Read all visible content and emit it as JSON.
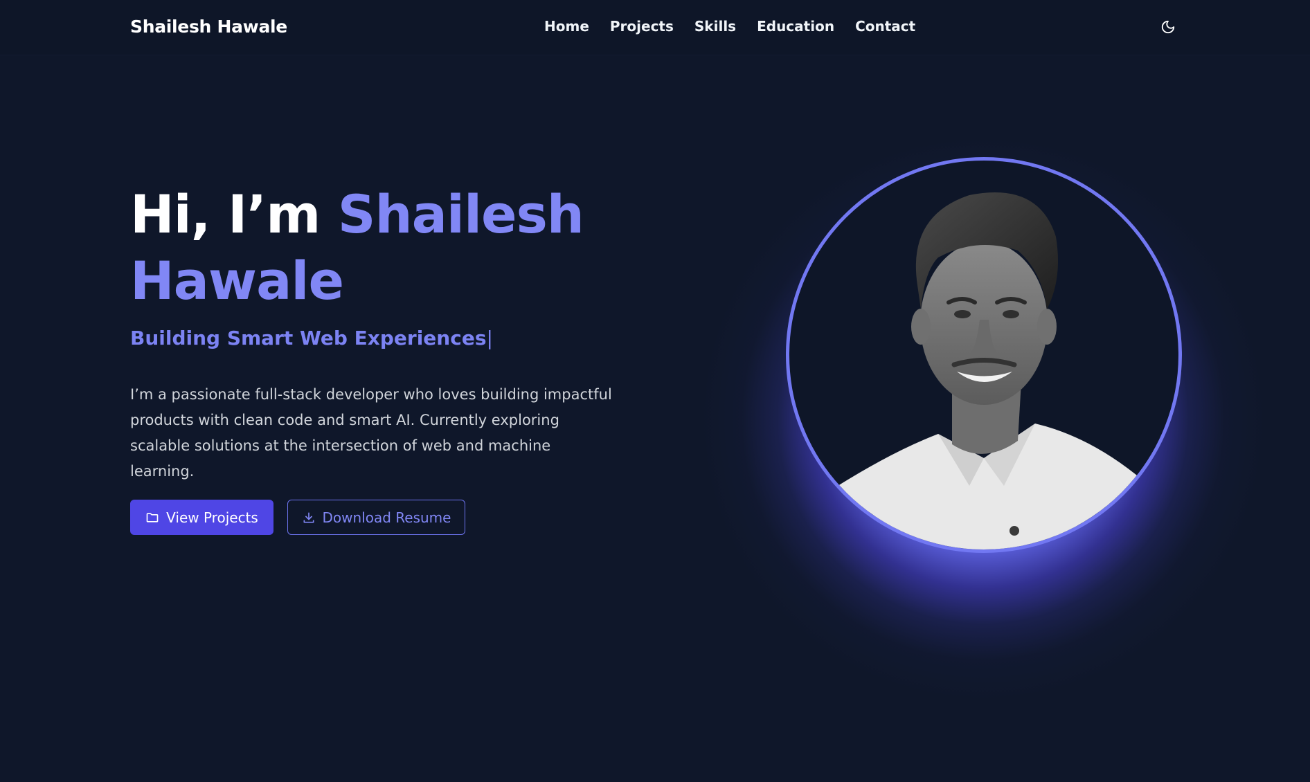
{
  "header": {
    "brand": "Shailesh Hawale",
    "nav": [
      {
        "label": "Home"
      },
      {
        "label": "Projects"
      },
      {
        "label": "Skills"
      },
      {
        "label": "Education"
      },
      {
        "label": "Contact"
      }
    ],
    "theme_icon": "moon-icon"
  },
  "hero": {
    "greeting": "Hi, I’m ",
    "name": "Shailesh Hawale",
    "tagline": "Building Smart Web Experiences",
    "cursor": "|",
    "intro": "I’m a passionate full-stack developer who loves building impactful products with clean code and smart AI. Currently exploring scalable solutions at the intersection of web and machine learning.",
    "buttons": {
      "primary": {
        "label": "View Projects",
        "icon": "folder-icon"
      },
      "secondary": {
        "label": "Download Resume",
        "icon": "download-icon"
      }
    }
  },
  "colors": {
    "background": "#0f172a",
    "accent": "#8187f5",
    "primary_button": "#4f46e5"
  }
}
